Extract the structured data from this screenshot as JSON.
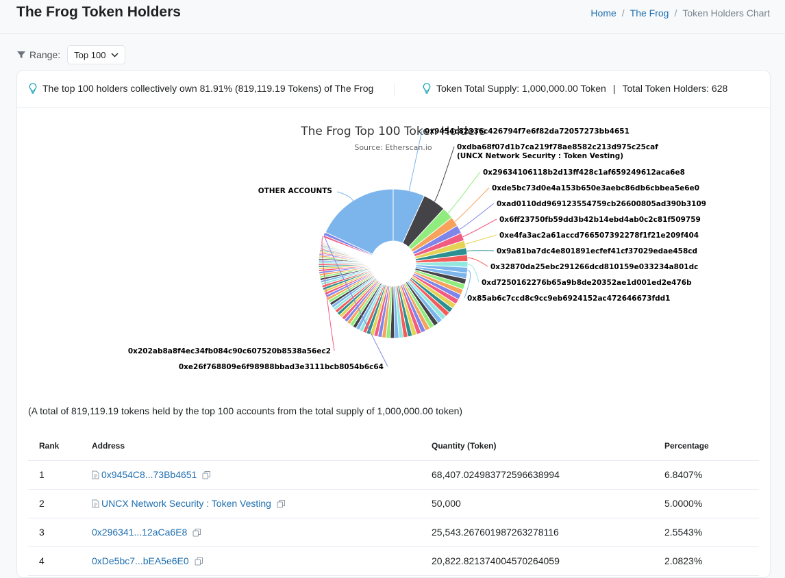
{
  "page": {
    "title": "The Frog Token Holders",
    "breadcrumb": [
      "Home",
      "The Frog",
      "Token Holders Chart"
    ]
  },
  "range": {
    "label": "Range:",
    "selected": "Top 100"
  },
  "info": {
    "top_holders_text": "The top 100 holders collectively own 81.91% (819,119.19 Tokens) of The Frog",
    "total_supply_text": "Token Total Supply: 1,000,000.00 Token",
    "total_holders_text": "Total Token Holders: 628",
    "separator": "|"
  },
  "chart_data": {
    "type": "pie",
    "title": "The Frog Top 100 Token Holders",
    "subtitle": "Source: Etherscan.io",
    "labels": [
      "0x9454c82336c426794f7e6f82da72057273bb4651",
      "0xdba68f07d1b7ca219f78ae8582c213d975c25caf",
      "(UNCX Network Security : Token Vesting)",
      "0x29634106118b2d13ff428c1af659249612aca6e8",
      "0xde5bc73d0e4a153b650e3aebc86db6cbbea5e6e0",
      "0xad0110dd969123554759cb26600805ad390b3109",
      "0x6ff23750fb59dd3b42b14ebd4ab0c2c81f509759",
      "0xe4fa3ac2a61accd766507392278f1f21e209f404",
      "0x9a81ba7dc4e801891ecfef41cf37029edae458cd",
      "0x32870da25ebc291266dcd810159e033234a801dc",
      "0xd7250162276b65a9b8de20352ae1d001ed2e476b",
      "0x85ab6c7ccd8c9cc9eb6924152ac472646673fdd1",
      "0xe26f768809e6f98988bbad3e3111bcb8054b6c64",
      "0x202ab8a8f4ec34fb084c90c607520b8538a56ec2",
      "OTHER ACCOUNTS"
    ],
    "slices": [
      {
        "label": "0x9454c82336c426794f7e6f82da72057273bb4651",
        "value": 6.8407,
        "color": "#7cb5ec"
      },
      {
        "label": "0xdba68f07d1b7ca219f78ae8582c213d975c25caf",
        "value": 5.0,
        "color": "#434348"
      },
      {
        "label": "0x29634106118b2d13ff428c1af659249612aca6e8",
        "value": 2.5543,
        "color": "#90ed7d"
      },
      {
        "label": "0xde5bc73d0e4a153b650e3aebc86db6cbbea5e6e0",
        "value": 2.0823,
        "color": "#f7a35c"
      },
      {
        "label": "0xad0110dd969123554759cb26600805ad390b3109",
        "value": 1.8,
        "color": "#8085e9"
      },
      {
        "label": "0x6ff23750fb59dd3b42b14ebd4ab0c2c81f509759",
        "value": 1.7,
        "color": "#f15c80"
      },
      {
        "label": "0xe4fa3ac2a61accd766507392278f1f21e209f404",
        "value": 1.6,
        "color": "#e4d354"
      },
      {
        "label": "0x9a81ba7dc4e801891ecfef41cf37029edae458cd",
        "value": 1.5,
        "color": "#2b908f"
      },
      {
        "label": "0x32870da25ebc291266dcd810159e033234a801dc",
        "value": 1.4,
        "color": "#f45b5b"
      },
      {
        "label": "0xd7250162276b65a9b8de20352ae1d001ed2e476b",
        "value": 1.3,
        "color": "#91e8e1"
      },
      {
        "label": "0x85ab6c7ccd8c9cc9eb6924152ac472646673fdd1",
        "value": 1.25,
        "color": "#7cb5ec"
      },
      {
        "label": "0xe26f768809e6f98988bbad3e3111bcb8054b6c64",
        "value": 0.7,
        "color": "#8085e9"
      },
      {
        "label": "0x202ab8a8f4ec34fb084c90c607520b8538a56ec2",
        "value": 0.5,
        "color": "#f15c80"
      },
      {
        "label": "OTHER ACCOUNTS",
        "value": 18.09,
        "color": "#7cb5ec"
      }
    ]
  },
  "total_note": "(A total of 819,119.19 tokens held by the top 100 accounts from the total supply of 1,000,000.00 token)",
  "table": {
    "headers": [
      "Rank",
      "Address",
      "Quantity (Token)",
      "Percentage"
    ],
    "rows": [
      {
        "rank": "1",
        "address": "0x9454C8...73Bb4651",
        "quantity": "68,407.024983772596638994",
        "percentage": "6.8407%",
        "doc": true
      },
      {
        "rank": "2",
        "address": "UNCX Network Security : Token Vesting",
        "quantity": "50,000",
        "percentage": "5.0000%",
        "doc": true
      },
      {
        "rank": "3",
        "address": "0x296341...12aCa6E8",
        "quantity": "25,543.267601987263278116",
        "percentage": "2.5543%",
        "doc": false
      },
      {
        "rank": "4",
        "address": "0xDe5bc7...bEA5e6E0",
        "quantity": "20,822.821374004570264059",
        "percentage": "2.0823%",
        "doc": false
      }
    ]
  }
}
